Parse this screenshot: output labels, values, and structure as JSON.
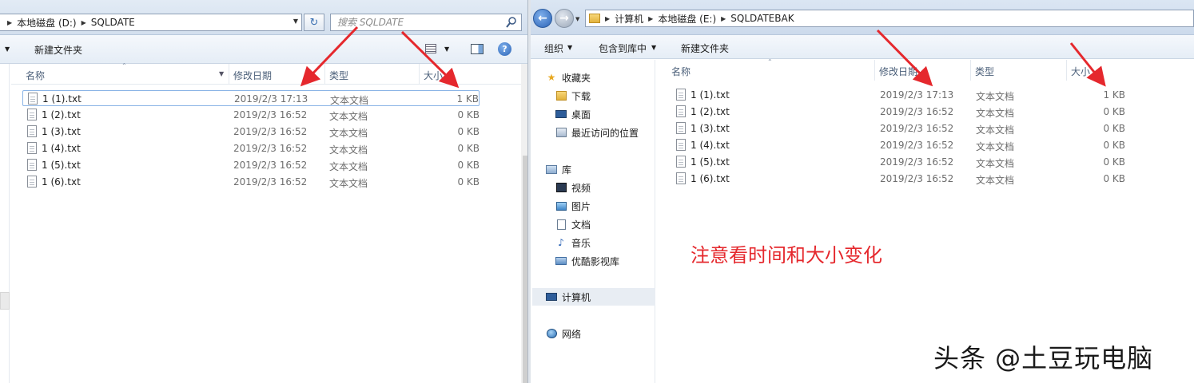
{
  "left_window": {
    "breadcrumb": [
      "本地磁盘 (D:)",
      "SQLDATE"
    ],
    "search": {
      "placeholder": "搜索 SQLDATE"
    },
    "toolbar": {
      "new_folder": "新建文件夹"
    },
    "columns": {
      "name": "名称",
      "date": "修改日期",
      "type": "类型",
      "size": "大小"
    },
    "files": [
      {
        "name": "1 (1).txt",
        "date": "2019/2/3 17:13",
        "type": "文本文档",
        "size": "1 KB"
      },
      {
        "name": "1 (2).txt",
        "date": "2019/2/3 16:52",
        "type": "文本文档",
        "size": "0 KB"
      },
      {
        "name": "1 (3).txt",
        "date": "2019/2/3 16:52",
        "type": "文本文档",
        "size": "0 KB"
      },
      {
        "name": "1 (4).txt",
        "date": "2019/2/3 16:52",
        "type": "文本文档",
        "size": "0 KB"
      },
      {
        "name": "1 (5).txt",
        "date": "2019/2/3 16:52",
        "type": "文本文档",
        "size": "0 KB"
      },
      {
        "name": "1 (6).txt",
        "date": "2019/2/3 16:52",
        "type": "文本文档",
        "size": "0 KB"
      }
    ]
  },
  "right_window": {
    "breadcrumb": [
      "计算机",
      "本地磁盘 (E:)",
      "SQLDATEBAK"
    ],
    "toolbar": {
      "organize": "组织",
      "include_library": "包含到库中",
      "new_folder": "新建文件夹"
    },
    "nav": {
      "favorites": "收藏夹",
      "downloads": "下载",
      "desktop": "桌面",
      "recent": "最近访问的位置",
      "libraries": "库",
      "videos": "视频",
      "pictures": "图片",
      "documents": "文档",
      "music": "音乐",
      "youku": "优酷影视库",
      "computer": "计算机",
      "network": "网络"
    },
    "columns": {
      "name": "名称",
      "date": "修改日期",
      "type": "类型",
      "size": "大小"
    },
    "files": [
      {
        "name": "1 (1).txt",
        "date": "2019/2/3 17:13",
        "type": "文本文档",
        "size": "1 KB"
      },
      {
        "name": "1 (2).txt",
        "date": "2019/2/3 16:52",
        "type": "文本文档",
        "size": "0 KB"
      },
      {
        "name": "1 (3).txt",
        "date": "2019/2/3 16:52",
        "type": "文本文档",
        "size": "0 KB"
      },
      {
        "name": "1 (4).txt",
        "date": "2019/2/3 16:52",
        "type": "文本文档",
        "size": "0 KB"
      },
      {
        "name": "1 (5).txt",
        "date": "2019/2/3 16:52",
        "type": "文本文档",
        "size": "0 KB"
      },
      {
        "name": "1 (6).txt",
        "date": "2019/2/3 16:52",
        "type": "文本文档",
        "size": "0 KB"
      }
    ]
  },
  "annotation": "注意看时间和大小变化",
  "watermark": "头条 @土豆玩电脑",
  "colors": {
    "arrow": "#e5282d",
    "annotation": "#e5282d",
    "accent": "#2b63b6"
  }
}
